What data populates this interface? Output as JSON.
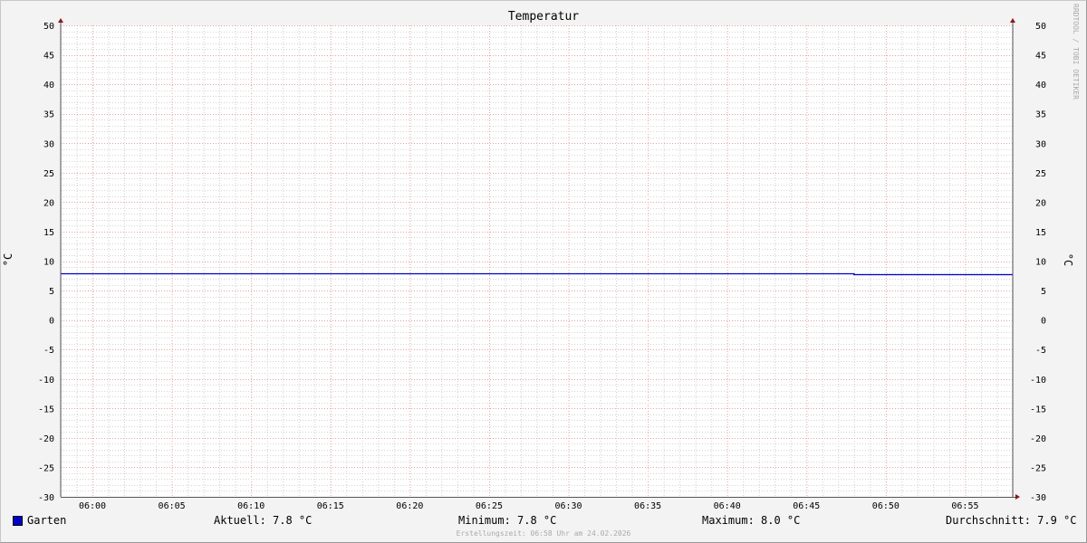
{
  "chart_data": {
    "type": "line",
    "title": "Temperatur",
    "ylabel": "°C",
    "ylabel_right": "°C",
    "ylim": [
      -30,
      50
    ],
    "yticks": [
      50,
      45,
      40,
      35,
      30,
      25,
      20,
      15,
      10,
      5,
      0,
      -5,
      -10,
      -15,
      -20,
      -25,
      -30
    ],
    "xlim": [
      "05:58",
      "06:58"
    ],
    "xticks": [
      "06:00",
      "06:05",
      "06:10",
      "06:15",
      "06:20",
      "06:25",
      "06:30",
      "06:35",
      "06:40",
      "06:45",
      "06:50",
      "06:55"
    ],
    "grid": true,
    "series": [
      {
        "name": "Garten",
        "color": "#0000cc",
        "x": [
          "05:58",
          "06:48",
          "06:48",
          "06:58"
        ],
        "y": [
          8.0,
          8.0,
          7.8,
          7.8
        ]
      }
    ],
    "legend_position": "bottom-left"
  },
  "legend": {
    "series_label": "Garten",
    "aktuell": "Aktuell: 7.8 °C",
    "minimum": "Minimum: 7.8 °C",
    "maximum": "Maximum: 8.0 °C",
    "durchschnitt": "Durchschnitt: 7.9 °C"
  },
  "footer": "Erstellungszeit: 06:58 Uhr am 24.02.2026",
  "watermark": "RRDTOOL / TOBI OETIKER"
}
